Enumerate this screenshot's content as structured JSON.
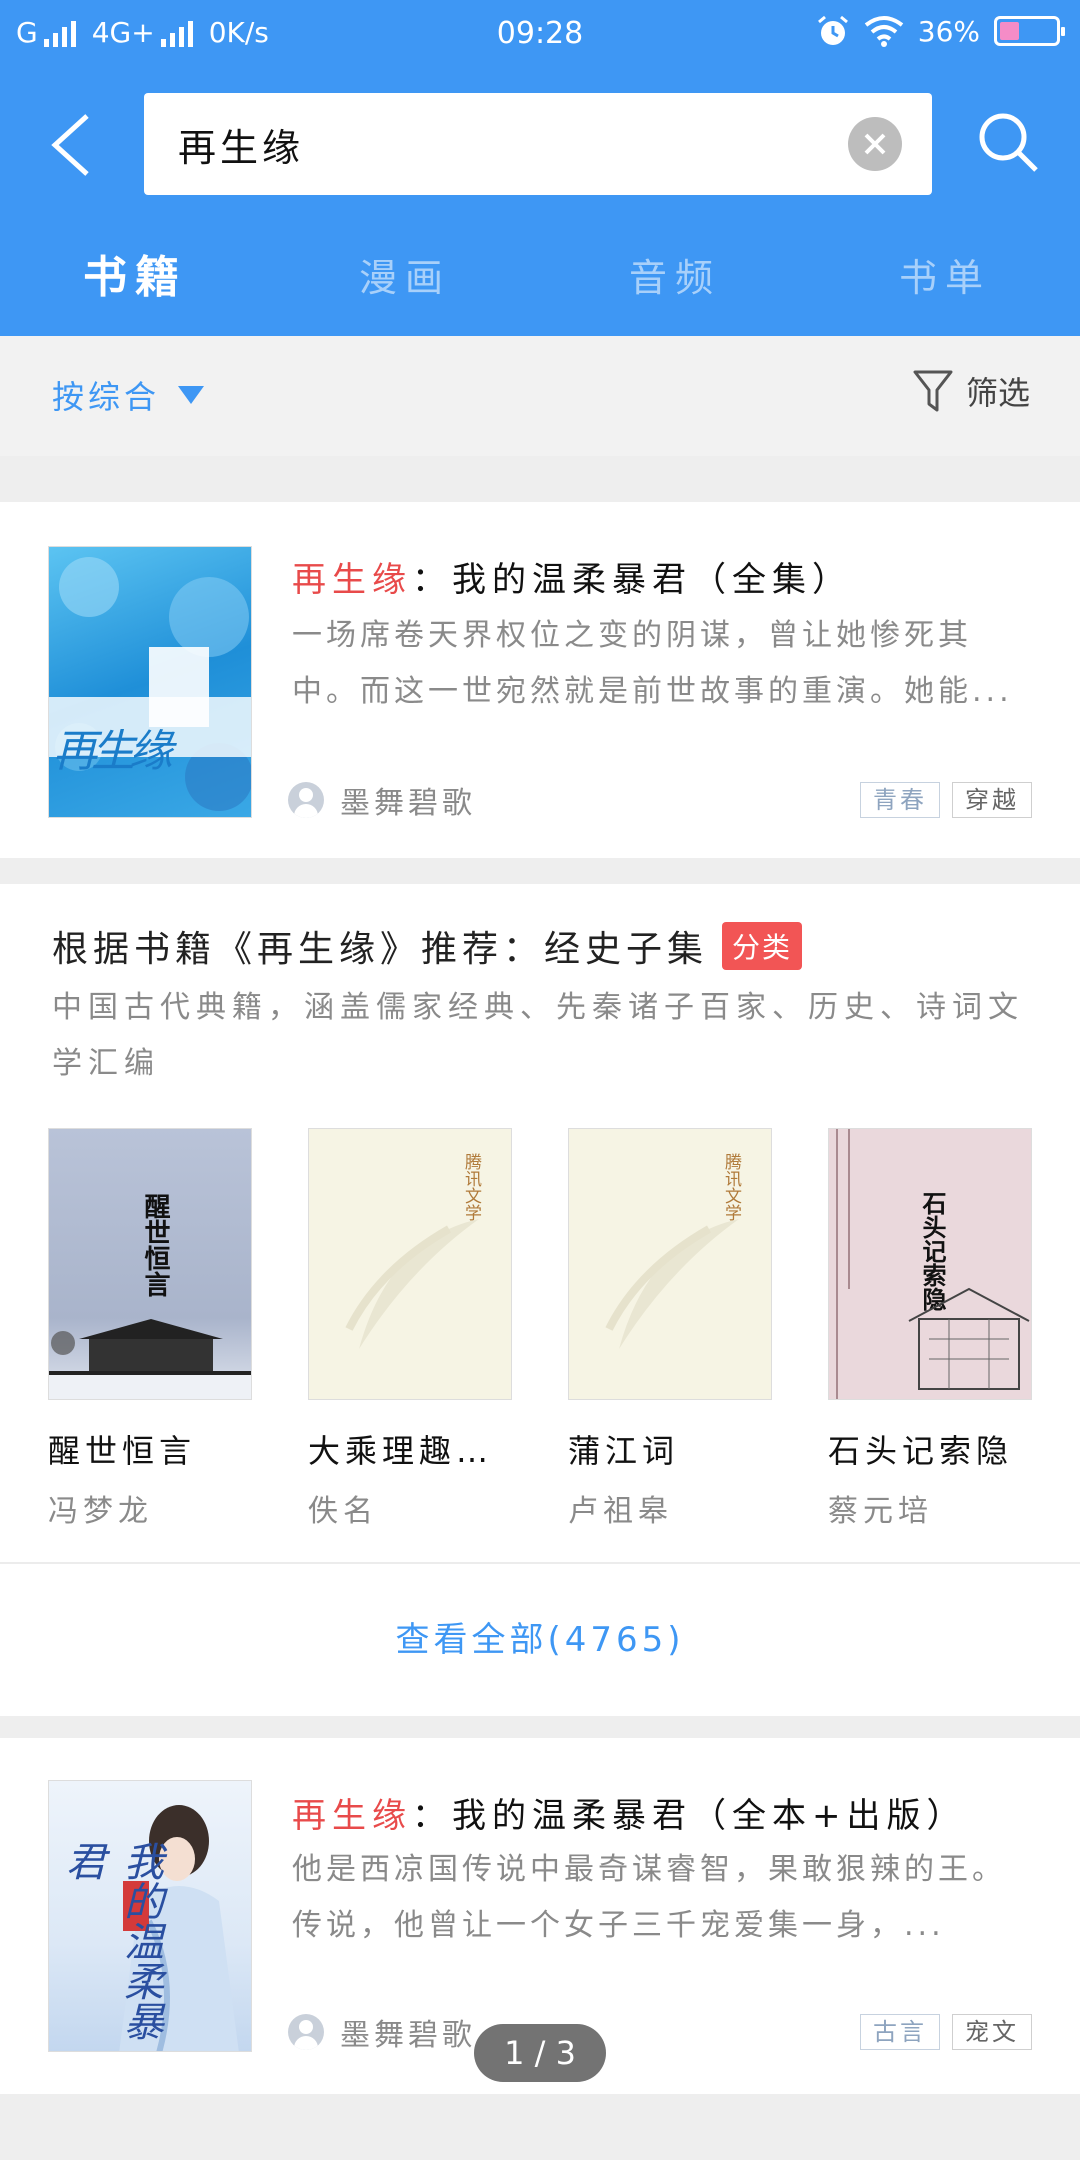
{
  "status_bar": {
    "carrier": "G",
    "network": "4G+",
    "speed": "0K/s",
    "time": "09:28",
    "battery": "36%",
    "battery_level": 0.36
  },
  "search": {
    "query": "再生缘"
  },
  "tabs": [
    {
      "label": "书籍",
      "active": true
    },
    {
      "label": "漫画",
      "active": false
    },
    {
      "label": "音频",
      "active": false
    },
    {
      "label": "书单",
      "active": false
    }
  ],
  "sort": {
    "label": "按综合",
    "filter_label": "筛选"
  },
  "results": [
    {
      "title_highlight": "再生缘",
      "title_rest": "：我的温柔暴君（全集）",
      "description": "一场席卷天界权位之变的阴谋，曾让她惨死其中。而这一世宛然就是前世故事的重演。她能...",
      "author": "墨舞碧歌",
      "tags": [
        "青春",
        "穿越"
      ],
      "cover_text": "再生缘"
    },
    {
      "title_highlight": "再生缘",
      "title_rest": "：我的温柔暴君（全本+出版）",
      "description": "他是西凉国传说中最奇谋睿智，果敢狠辣的王。传说，他曾让一个女子三千宠爱集一身，...",
      "author": "墨舞碧歌",
      "tags": [
        "古言",
        "宠文"
      ],
      "cover_text": "我的温柔暴君"
    }
  ],
  "recommendation": {
    "title": "根据书籍《再生缘》推荐：经史子集",
    "badge": "分类",
    "description": "中国古代典籍，涵盖儒家经典、先秦诸子百家、历史、诗词文学汇编",
    "books": [
      {
        "name": "醒世恒言",
        "author": "冯梦龙",
        "cover_text": "醒世恒言"
      },
      {
        "name": "大乘理趣六...",
        "author": "佚名",
        "cover_text": "腾讯文学"
      },
      {
        "name": "蒲江词",
        "author": "卢祖皋",
        "cover_text": "腾讯文学"
      },
      {
        "name": "石头记索隐",
        "author": "蔡元培",
        "cover_text": "石头记索隐"
      }
    ],
    "view_all": "查看全部(4765)"
  },
  "pagination": "1 / 3",
  "colors": {
    "accent": "#3e97f4",
    "highlight": "#e84a4a",
    "badge": "#f25555"
  }
}
